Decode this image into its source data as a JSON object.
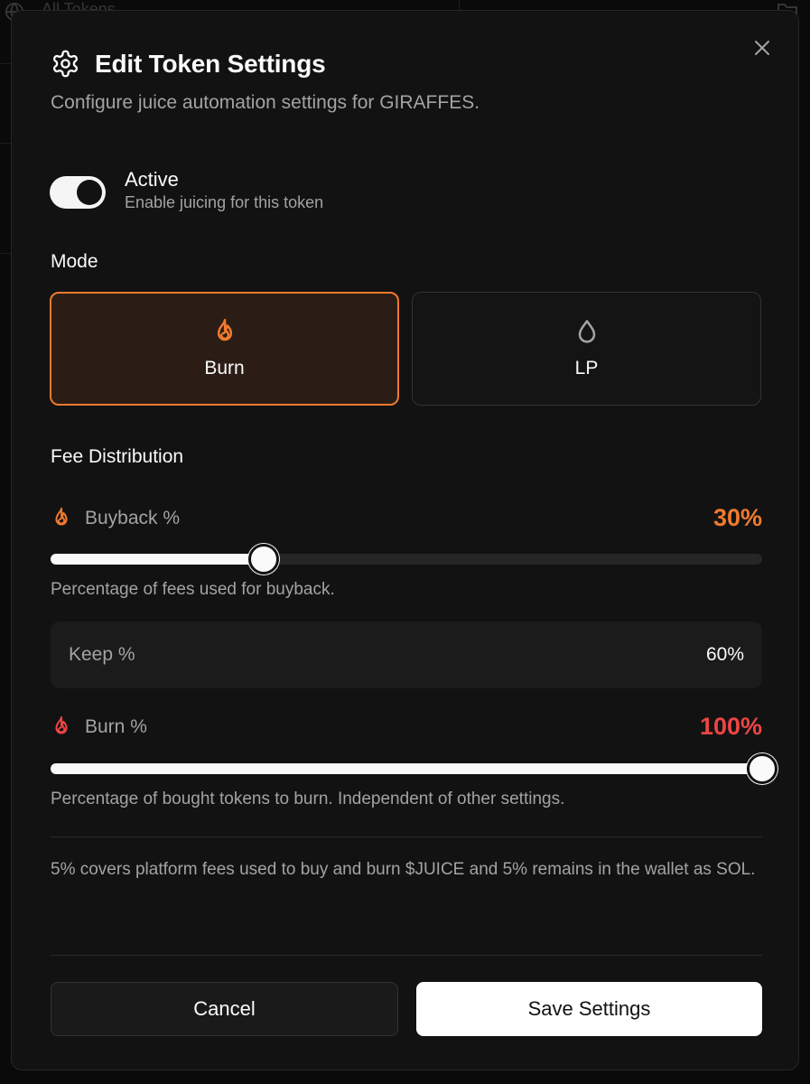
{
  "background": {
    "title": "All Tokens"
  },
  "modal": {
    "title": "Edit Token Settings",
    "subtitle": "Configure juice automation settings for GIRAFFES.",
    "close_icon": "close-icon"
  },
  "active": {
    "label": "Active",
    "description": "Enable juicing for this token",
    "enabled": true
  },
  "mode": {
    "section_label": "Mode",
    "options": [
      {
        "label": "Burn",
        "icon": "flame-icon",
        "selected": true
      },
      {
        "label": "LP",
        "icon": "droplet-icon",
        "selected": false
      }
    ]
  },
  "fee_distribution": {
    "section_label": "Fee Distribution",
    "buyback": {
      "label": "Buyback %",
      "value_text": "30%",
      "value": 30,
      "help": "Percentage of fees used for buyback.",
      "color": "#f07a2e"
    },
    "keep": {
      "label": "Keep %",
      "value_text": "60%"
    },
    "burn": {
      "label": "Burn %",
      "value_text": "100%",
      "value": 100,
      "help": "Percentage of bought tokens to burn. Independent of other settings.",
      "color": "#ef4444"
    }
  },
  "note": "5% covers platform fees used to buy and burn $JUICE and 5% remains in the wallet as SOL.",
  "buttons": {
    "cancel": "Cancel",
    "save": "Save Settings"
  },
  "colors": {
    "accent": "#ef7a2f",
    "modal_bg": "#121212",
    "burn_card_bg": "#2b1d15"
  }
}
